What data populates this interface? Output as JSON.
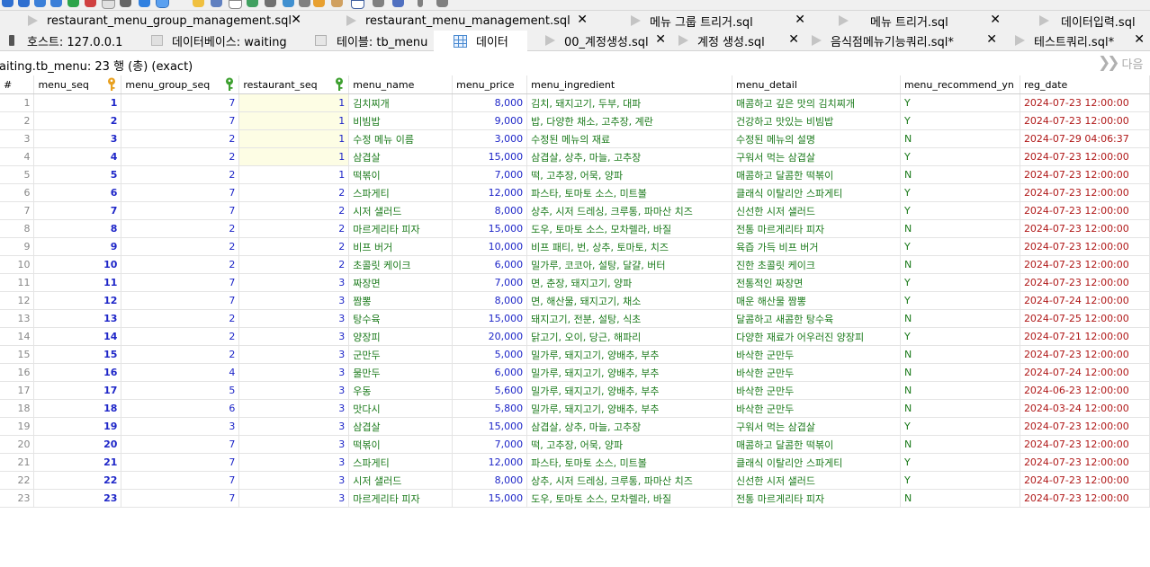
{
  "tabs_row1": [
    {
      "label": "restaurant_menu_group_management.sql",
      "closable": true
    },
    {
      "label": "restaurant_menu_management.sql",
      "closable": true
    },
    {
      "label": "메뉴 그룹 트리거.sql",
      "closable": true
    },
    {
      "label": "메뉴 트리거.sql",
      "closable": true
    },
    {
      "label": "데이터입력.sql",
      "closable": false
    }
  ],
  "tabs_row2": [
    {
      "label": "호스트: 127.0.0.1",
      "icon": "server-icon",
      "closable": false
    },
    {
      "label": "데이터베이스: waiting",
      "icon": "database-icon",
      "closable": false
    },
    {
      "label": "테이블: tb_menu",
      "icon": "table-icon",
      "closable": false
    },
    {
      "label": "데이터",
      "icon": "data-grid-icon",
      "closable": false,
      "active": true
    },
    {
      "label": "00_계정생성.sql",
      "icon": "sql-file-icon",
      "closable": true
    },
    {
      "label": "계정 생성.sql",
      "icon": "sql-file-icon",
      "closable": true
    },
    {
      "label": "음식점메뉴기능쿼리.sql*",
      "icon": "sql-file-icon",
      "closable": true
    },
    {
      "label": "테스트쿼리.sql*",
      "icon": "sql-file-icon",
      "closable": true
    }
  ],
  "info": {
    "text": "aiting.tb_menu: 23 행 (총) (exact)",
    "next_label": "다음"
  },
  "grid": {
    "columns": [
      "#",
      "menu_seq",
      "menu_group_seq",
      "restaurant_seq",
      "menu_name",
      "menu_price",
      "menu_ingredient",
      "menu_detail",
      "menu_recommend_yn",
      "reg_date"
    ],
    "key_icons": {
      "menu_seq": "primary-key",
      "menu_group_seq": "foreign-key",
      "restaurant_seq": "foreign-key"
    },
    "colors": {
      "number": "#1e26c8",
      "text": "#1a7a1a",
      "date": "#b01818",
      "highlight": "#fdfde4"
    },
    "rows": [
      [
        "1",
        "1",
        "7",
        "1",
        "김치찌개",
        "8,000",
        "김치, 돼지고기, 두부, 대파",
        "매콤하고 깊은 맛의 김치찌개",
        "Y",
        "2024-07-23 12:00:00"
      ],
      [
        "2",
        "2",
        "7",
        "1",
        "비빔밥",
        "9,000",
        "밥, 다양한 채소, 고추장, 계란",
        "건강하고 맛있는 비빔밥",
        "Y",
        "2024-07-23 12:00:00"
      ],
      [
        "3",
        "3",
        "2",
        "1",
        "수정 메뉴 이름",
        "3,000",
        "수정된 메뉴의 재료",
        "수정된 메뉴의 설명",
        "N",
        "2024-07-29 04:06:37"
      ],
      [
        "4",
        "4",
        "2",
        "1",
        "삼겹살",
        "15,000",
        "삼겹살, 상추, 마늘, 고추장",
        "구워서 먹는 삼겹살",
        "Y",
        "2024-07-23 12:00:00"
      ],
      [
        "5",
        "5",
        "2",
        "1",
        "떡볶이",
        "7,000",
        "떡, 고추장, 어묵, 양파",
        "매콤하고 달콤한 떡볶이",
        "N",
        "2024-07-23 12:00:00"
      ],
      [
        "6",
        "6",
        "7",
        "2",
        "스파게티",
        "12,000",
        "파스타, 토마토 소스, 미트볼",
        "클래식 이탈리안 스파게티",
        "Y",
        "2024-07-23 12:00:00"
      ],
      [
        "7",
        "7",
        "7",
        "2",
        "시저 샐러드",
        "8,000",
        "상추, 시저 드레싱, 크루통, 파마산 치즈",
        "신선한 시저 샐러드",
        "Y",
        "2024-07-23 12:00:00"
      ],
      [
        "8",
        "8",
        "2",
        "2",
        "마르게리타 피자",
        "15,000",
        "도우, 토마토 소스, 모차렐라, 바질",
        "전통 마르게리타 피자",
        "N",
        "2024-07-23 12:00:00"
      ],
      [
        "9",
        "9",
        "2",
        "2",
        "비프 버거",
        "10,000",
        "비프 패티, 번, 상추, 토마토, 치즈",
        "육즙 가득 비프 버거",
        "Y",
        "2024-07-23 12:00:00"
      ],
      [
        "10",
        "10",
        "2",
        "2",
        "초콜릿 케이크",
        "6,000",
        "밀가루, 코코아, 설탕, 달걀, 버터",
        "진한 초콜릿 케이크",
        "N",
        "2024-07-23 12:00:00"
      ],
      [
        "11",
        "11",
        "7",
        "3",
        "짜장면",
        "7,000",
        "면, 춘장, 돼지고기, 양파",
        "전통적인 짜장면",
        "Y",
        "2024-07-23 12:00:00"
      ],
      [
        "12",
        "12",
        "7",
        "3",
        "짬뽕",
        "8,000",
        "면, 해산물, 돼지고기, 채소",
        "매운 해산물 짬뽕",
        "Y",
        "2024-07-24 12:00:00"
      ],
      [
        "13",
        "13",
        "2",
        "3",
        "탕수육",
        "15,000",
        "돼지고기, 전분, 설탕, 식초",
        "달콤하고 새콤한 탕수육",
        "N",
        "2024-07-25 12:00:00"
      ],
      [
        "14",
        "14",
        "2",
        "3",
        "양장피",
        "20,000",
        "닭고기, 오이, 당근, 해파리",
        "다양한 재료가 어우러진 양장피",
        "Y",
        "2024-07-21 12:00:00"
      ],
      [
        "15",
        "15",
        "2",
        "3",
        "군만두",
        "5,000",
        "밀가루, 돼지고기, 양배추, 부추",
        "바삭한 군만두",
        "N",
        "2024-07-23 12:00:00"
      ],
      [
        "16",
        "16",
        "4",
        "3",
        "물만두",
        "6,000",
        "밀가루, 돼지고기, 양배추, 부추",
        "바삭한 군만두",
        "N",
        "2024-07-24 12:00:00"
      ],
      [
        "17",
        "17",
        "5",
        "3",
        "우동",
        "5,600",
        "밀가루, 돼지고기, 양배추, 부추",
        "바삭한 군만두",
        "N",
        "2024-06-23 12:00:00"
      ],
      [
        "18",
        "18",
        "6",
        "3",
        "맛다시",
        "5,800",
        "밀가루, 돼지고기, 양배추, 부추",
        "바삭한 군만두",
        "N",
        "2024-03-24 12:00:00"
      ],
      [
        "19",
        "19",
        "3",
        "3",
        "삼겹살",
        "15,000",
        "삼겹살, 상추, 마늘, 고추장",
        "구워서 먹는 삼겹살",
        "Y",
        "2024-07-23 12:00:00"
      ],
      [
        "20",
        "20",
        "7",
        "3",
        "떡볶이",
        "7,000",
        "떡, 고추장, 어묵, 양파",
        "매콤하고 달콤한 떡볶이",
        "N",
        "2024-07-23 12:00:00"
      ],
      [
        "21",
        "21",
        "7",
        "3",
        "스파게티",
        "12,000",
        "파스타, 토마토 소스, 미트볼",
        "클래식 이탈리안 스파게티",
        "Y",
        "2024-07-23 12:00:00"
      ],
      [
        "22",
        "22",
        "7",
        "3",
        "시저 샐러드",
        "8,000",
        "상추, 시저 드레싱, 크루통, 파마산 치즈",
        "신선한 시저 샐러드",
        "Y",
        "2024-07-23 12:00:00"
      ],
      [
        "23",
        "23",
        "7",
        "3",
        "마르게리타 피자",
        "15,000",
        "도우, 토마토 소스, 모차렐라, 바질",
        "전통 마르게리타 피자",
        "N",
        "2024-07-23 12:00:00"
      ]
    ]
  }
}
